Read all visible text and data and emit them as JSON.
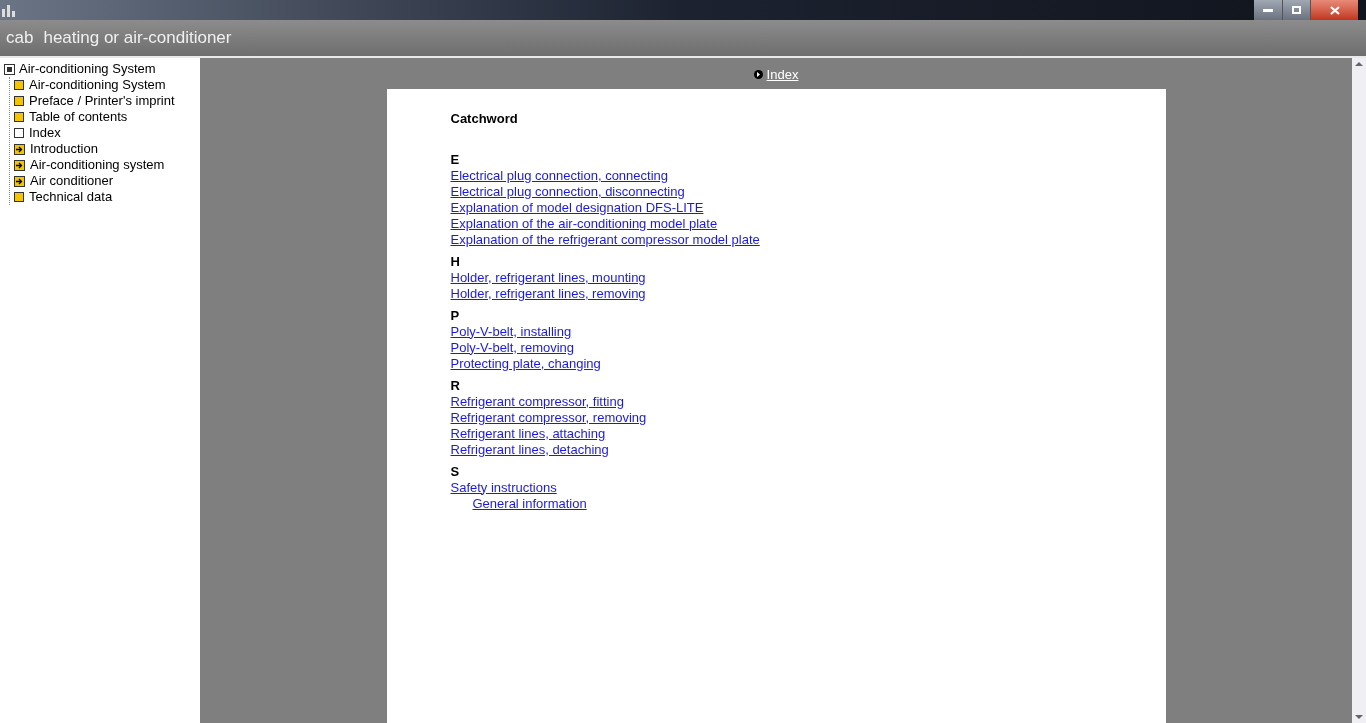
{
  "header": {
    "app": "cab",
    "title": "heating or air-conditioner"
  },
  "tree": {
    "label": "Air-conditioning System",
    "children": [
      {
        "label": "Air-conditioning System",
        "kind": "book"
      },
      {
        "label": "Preface / Printer's imprint",
        "kind": "book"
      },
      {
        "label": "Table of contents",
        "kind": "book"
      },
      {
        "label": "Index",
        "kind": "page"
      },
      {
        "label": "Introduction",
        "kind": "folder"
      },
      {
        "label": "Air-conditioning system",
        "kind": "folder"
      },
      {
        "label": "Air conditioner",
        "kind": "folder"
      },
      {
        "label": "Technical data",
        "kind": "book"
      }
    ]
  },
  "breadcrumb": "Index",
  "document": {
    "heading": "Catchword",
    "sections": [
      {
        "letter": "E",
        "links": [
          {
            "text": "Electrical plug connection, connecting"
          },
          {
            "text": "Electrical plug connection, disconnecting"
          },
          {
            "text": "Explanation of model designation DFS-LITE"
          },
          {
            "text": "Explanation of the air-conditioning model plate"
          },
          {
            "text": "Explanation of the refrigerant compressor model plate"
          }
        ]
      },
      {
        "letter": "H",
        "links": [
          {
            "text": "Holder, refrigerant lines, mounting"
          },
          {
            "text": "Holder, refrigerant lines, removing"
          }
        ]
      },
      {
        "letter": "P",
        "links": [
          {
            "text": "Poly-V-belt, installing"
          },
          {
            "text": "Poly-V-belt, removing"
          },
          {
            "text": "Protecting plate, changing"
          }
        ]
      },
      {
        "letter": "R",
        "links": [
          {
            "text": "Refrigerant compressor, fitting"
          },
          {
            "text": "Refrigerant compressor, removing"
          },
          {
            "text": "Refrigerant lines, attaching"
          },
          {
            "text": "Refrigerant lines, detaching"
          }
        ]
      },
      {
        "letter": "S",
        "links": [
          {
            "text": "Safety instructions",
            "children": [
              {
                "text": "General information"
              }
            ]
          }
        ]
      }
    ]
  }
}
